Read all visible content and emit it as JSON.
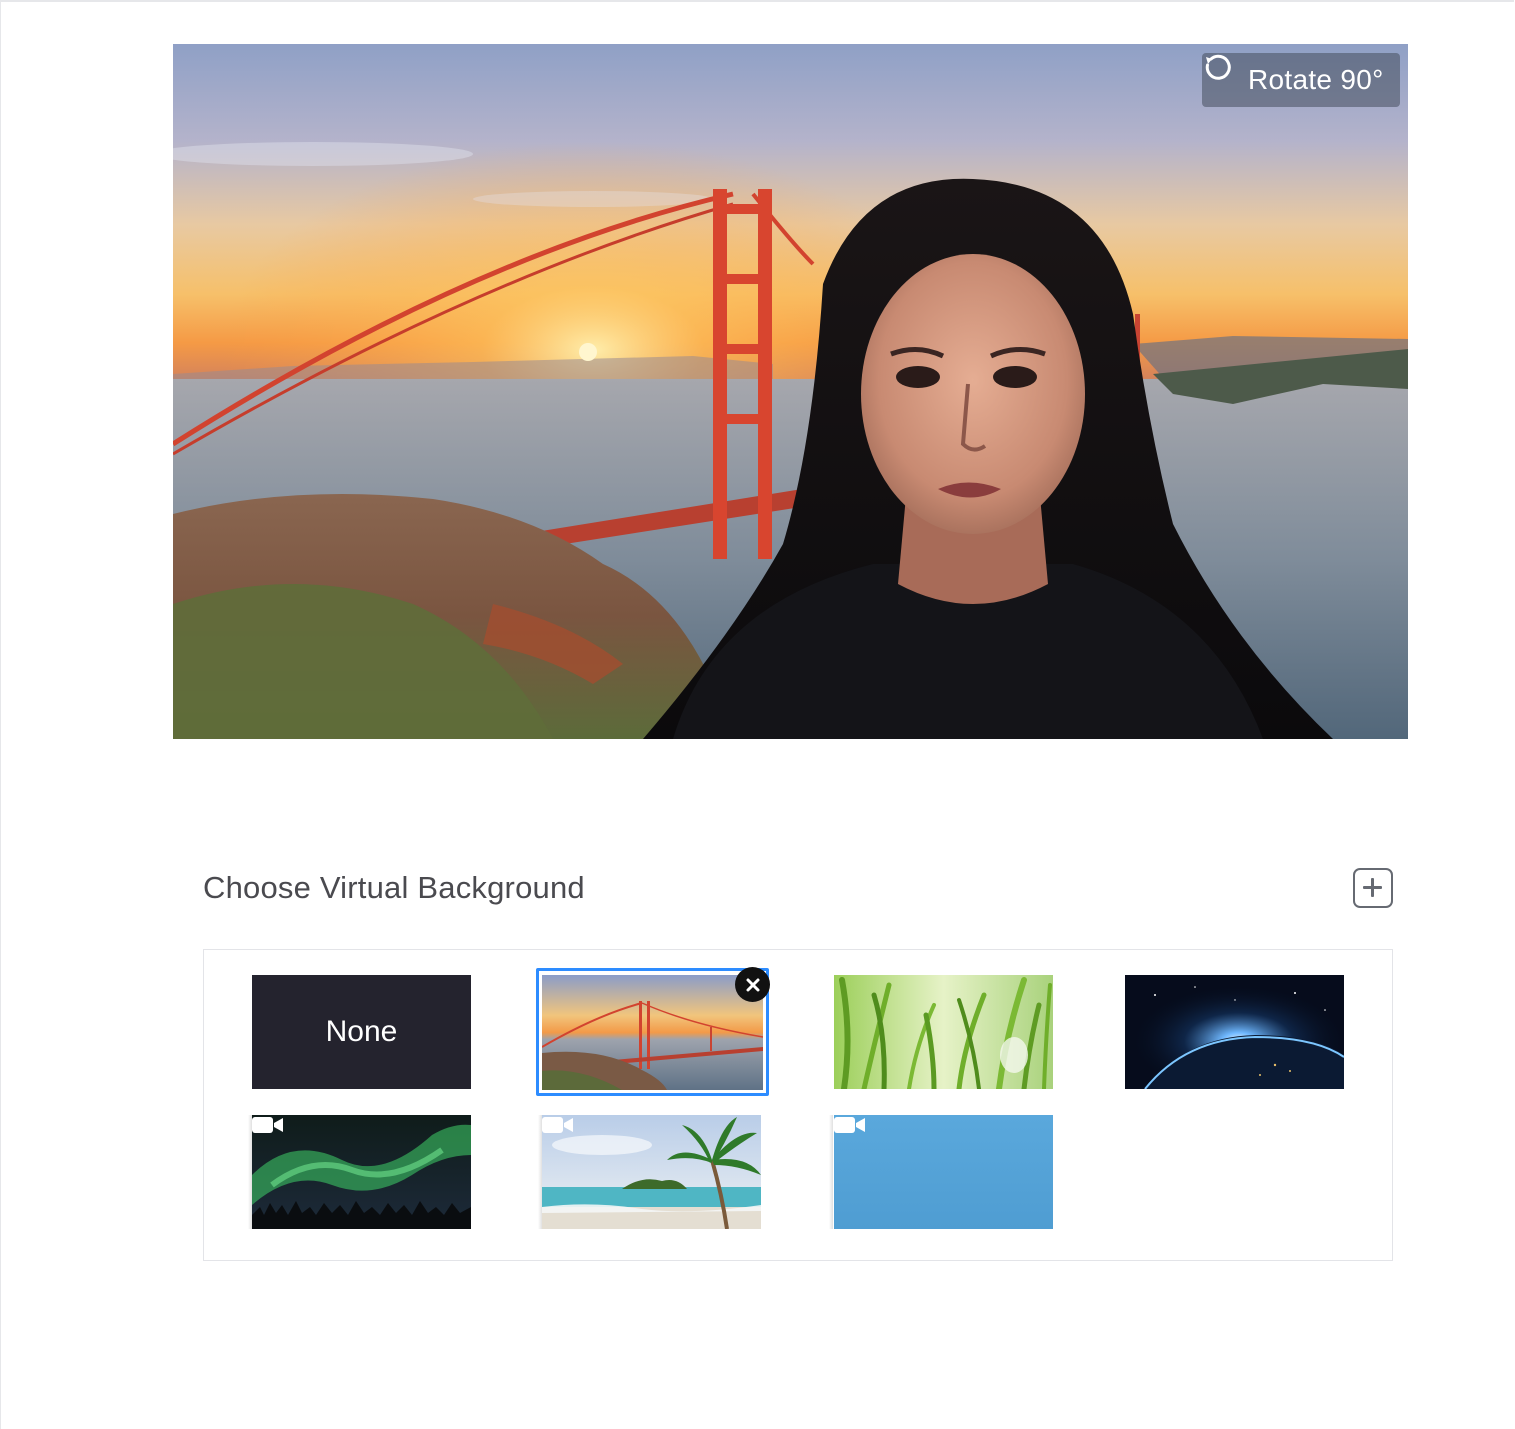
{
  "preview": {
    "rotate_label": "Rotate 90°",
    "rotate_icon": "rotate-ccw-icon"
  },
  "chooser": {
    "title": "Choose Virtual Background",
    "add_icon": "plus-square-icon",
    "remove_icon": "close-icon",
    "selected_index": 1,
    "items": [
      {
        "label": "None",
        "kind": "none",
        "video": false
      },
      {
        "label": "",
        "kind": "golden-gate-bridge",
        "video": false
      },
      {
        "label": "",
        "kind": "grass",
        "video": false
      },
      {
        "label": "",
        "kind": "earth-from-space",
        "video": false
      },
      {
        "label": "",
        "kind": "aurora",
        "video": true,
        "video_icon": "video-camera-icon"
      },
      {
        "label": "",
        "kind": "beach-palm",
        "video": true,
        "video_icon": "video-camera-icon"
      },
      {
        "label": "",
        "kind": "blue-solid",
        "video": true,
        "video_icon": "video-camera-icon"
      }
    ]
  },
  "colors": {
    "accent": "#2d8cff",
    "none_tile": "#24232e",
    "blue_tile": "#5aa8dc"
  }
}
